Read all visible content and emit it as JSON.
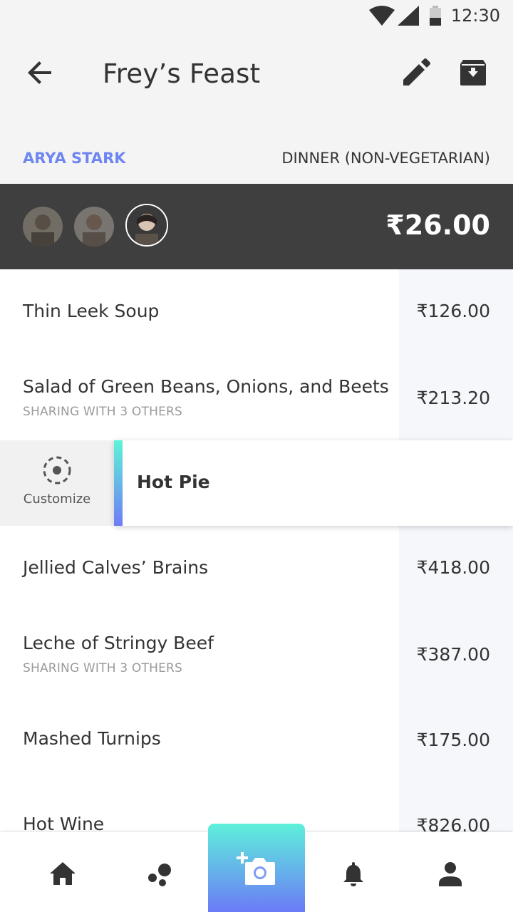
{
  "status": {
    "time": "12:30"
  },
  "header": {
    "title": "Frey’s Feast"
  },
  "meta": {
    "user": "ARYA STARK",
    "meal": "DINNER (NON-VEGETARIAN)"
  },
  "summary": {
    "total": "₹26.00",
    "avatars": [
      "avatar-1",
      "avatar-2",
      "avatar-active"
    ]
  },
  "items": [
    {
      "name": "Thin Leek Soup",
      "price": "₹126.00"
    },
    {
      "name": "Salad of Green Beans, Onions, and Beets",
      "sub": "SHARING WITH 3 OTHERS",
      "price": "₹213.20"
    },
    {
      "name": "Jellied Calves’ Brains",
      "price": "₹418.00"
    },
    {
      "name": "Leche of Stringy Beef",
      "sub": "SHARING WITH 3 OTHERS",
      "price": "₹387.00"
    },
    {
      "name": "Mashed Turnips",
      "price": "₹175.00"
    },
    {
      "name": "Hot Wine",
      "price": "₹826.00"
    }
  ],
  "swipe": {
    "item": "Hot Pie",
    "action": "Customize"
  },
  "nav": {
    "icons": [
      "home-icon",
      "bubbles-icon",
      "add-photo-icon",
      "bell-icon",
      "profile-icon"
    ]
  },
  "colors": {
    "accent": "#6f86f2",
    "dark_band": "#3f3f3f",
    "gradient_start": "#5ef3d8",
    "gradient_end": "#6e7cf6"
  }
}
